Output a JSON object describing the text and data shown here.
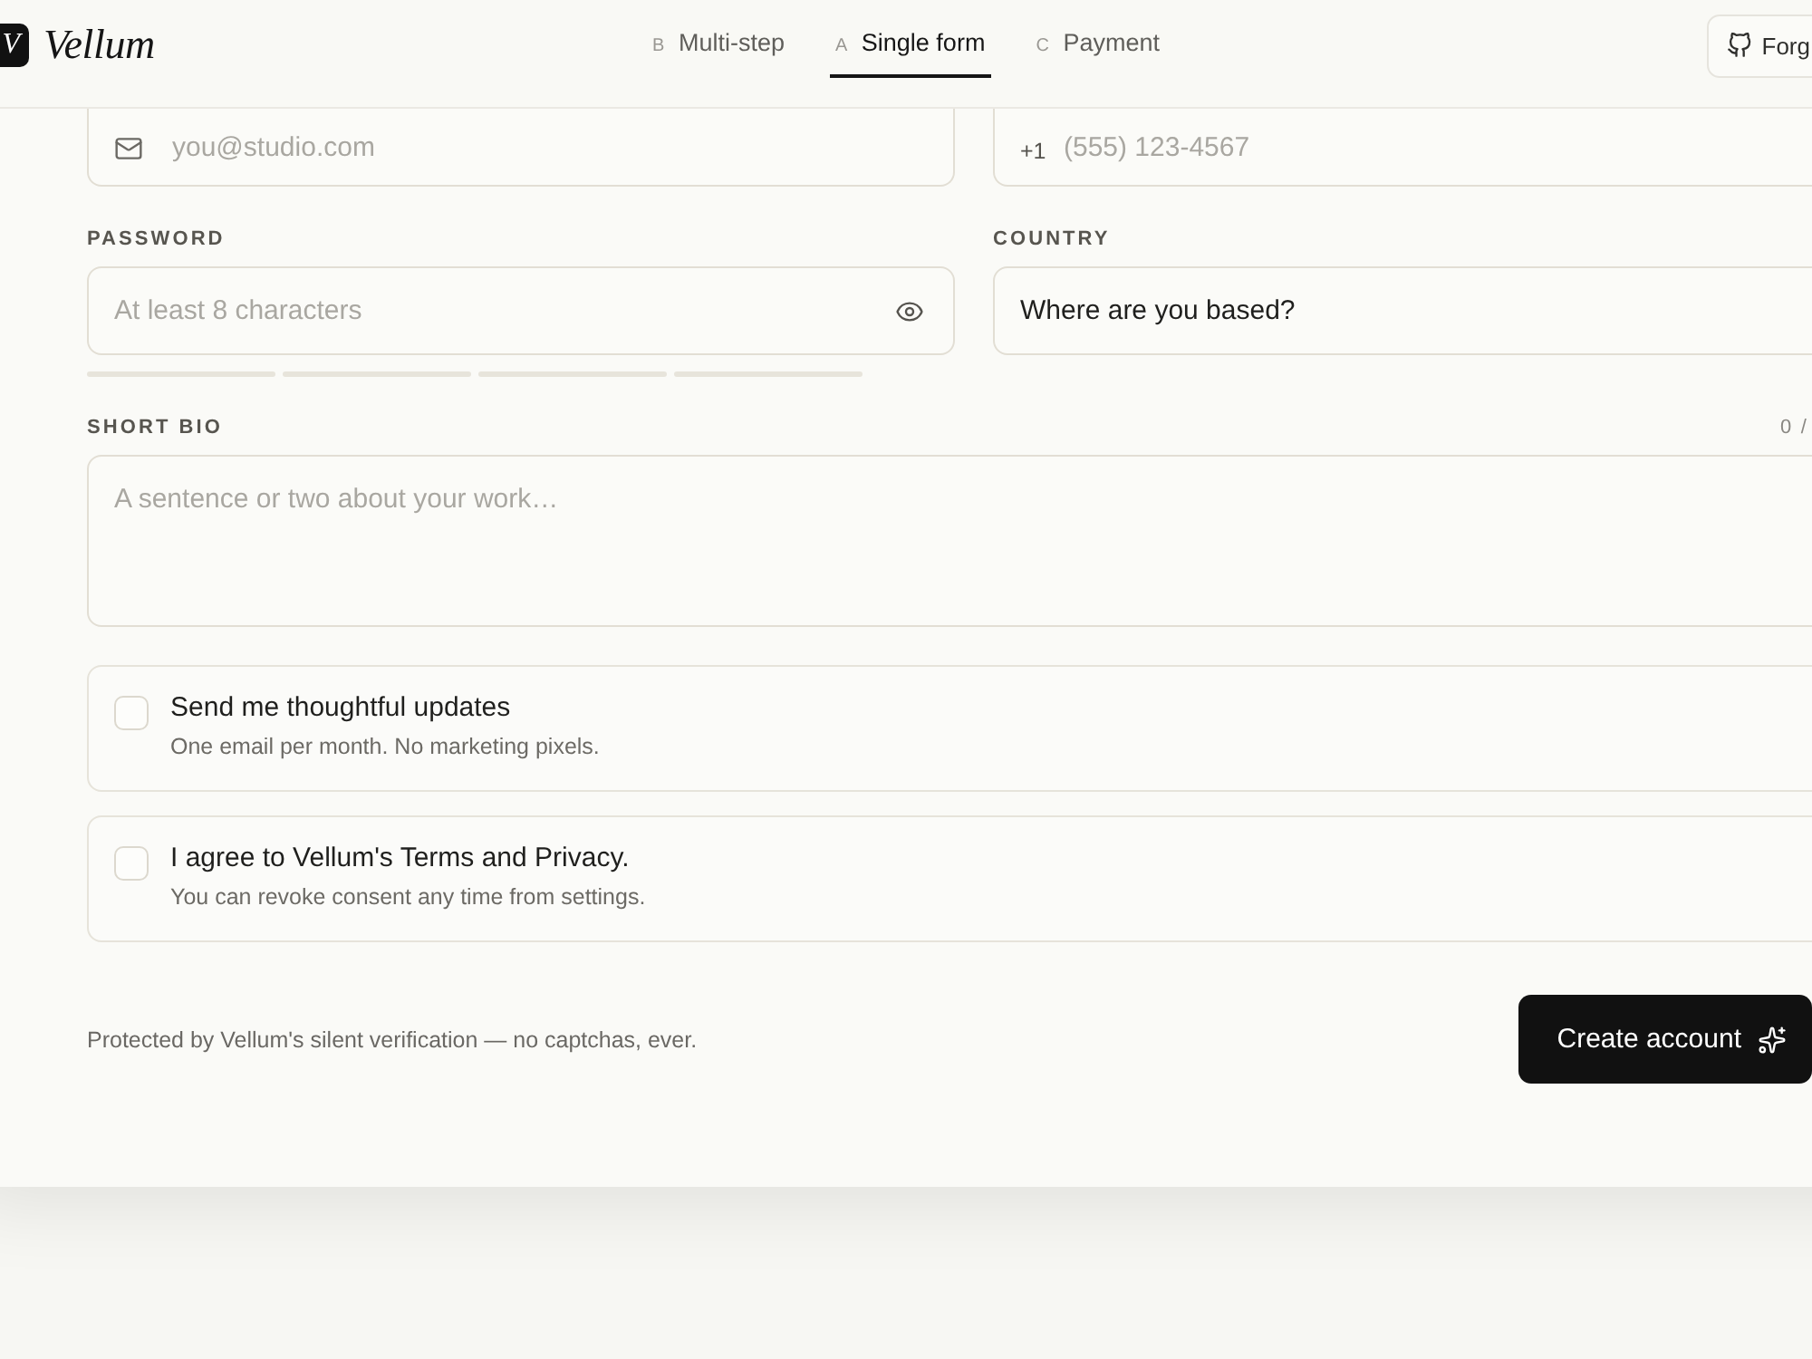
{
  "header": {
    "logo": {
      "mark": "V",
      "name": "Vellum"
    },
    "tabs": [
      {
        "key": "B",
        "label": "Multi-step",
        "selected": false
      },
      {
        "key": "A",
        "label": "Single form",
        "selected": true
      },
      {
        "key": "C",
        "label": "Payment",
        "selected": false
      }
    ],
    "action_button": {
      "label": "Forg"
    }
  },
  "form": {
    "email": {
      "placeholder": "you@studio.com"
    },
    "phone": {
      "prefix": "+1",
      "placeholder": "(555) 123-4567"
    },
    "password": {
      "label": "PASSWORD",
      "placeholder": "At least 8 characters",
      "strength": [
        {
          "filled": false
        },
        {
          "filled": false
        },
        {
          "filled": false
        },
        {
          "filled": false
        }
      ]
    },
    "country": {
      "label": "COUNTRY",
      "value": "Where are you based?"
    },
    "bio": {
      "label": "SHORT BIO",
      "counter": "0 /",
      "placeholder": "A sentence or two about your work…"
    },
    "consents": [
      {
        "title": "Send me thoughtful updates",
        "note": "One email per month. No marketing pixels.",
        "checked": false
      },
      {
        "title": "I agree to Vellum's Terms and Privacy.",
        "note": "You can revoke consent any time from settings.",
        "checked": false
      }
    ],
    "footer": {
      "note": "Protected by Vellum's silent verification — no captchas, ever.",
      "submit": "Create account"
    }
  }
}
